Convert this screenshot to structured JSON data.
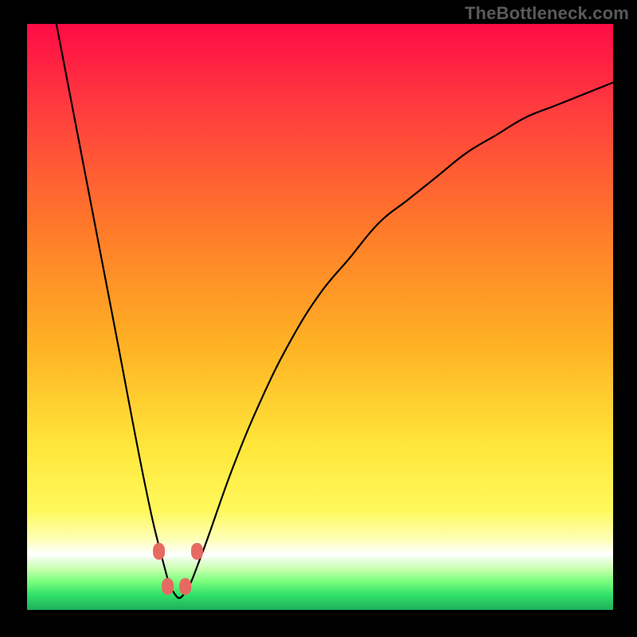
{
  "watermark": "TheBottleneck.com",
  "chart_data": {
    "type": "line",
    "title": "",
    "xlabel": "",
    "ylabel": "",
    "xlim": [
      0,
      100
    ],
    "ylim": [
      0,
      100
    ],
    "grid": false,
    "legend": false,
    "series": [
      {
        "name": "bottleneck-curve",
        "x": [
          5,
          10,
          15,
          20,
          23,
          25,
          27,
          30,
          35,
          40,
          45,
          50,
          55,
          60,
          65,
          70,
          75,
          80,
          85,
          90,
          95,
          100
        ],
        "y": [
          100,
          74,
          48,
          22,
          9,
          3,
          3,
          10,
          24,
          36,
          46,
          54,
          60,
          66,
          70,
          74,
          78,
          81,
          84,
          86,
          88,
          90
        ]
      }
    ],
    "good_band": {
      "y_start": 0,
      "y_end": 7
    },
    "markers": {
      "name": "curve-markers",
      "points": [
        {
          "x": 22.5,
          "y": 10
        },
        {
          "x": 24.0,
          "y": 4
        },
        {
          "x": 27.0,
          "y": 4
        },
        {
          "x": 29.0,
          "y": 10
        }
      ]
    },
    "gradient_stops": [
      {
        "offset": 0.0,
        "color": "#ff0b46"
      },
      {
        "offset": 0.15,
        "color": "#ff3e3e"
      },
      {
        "offset": 0.35,
        "color": "#ff7a2a"
      },
      {
        "offset": 0.55,
        "color": "#ffb224"
      },
      {
        "offset": 0.72,
        "color": "#ffe63a"
      },
      {
        "offset": 0.83,
        "color": "#fff95c"
      },
      {
        "offset": 0.88,
        "color": "#fdffb8"
      },
      {
        "offset": 0.905,
        "color": "#ffffff"
      },
      {
        "offset": 0.93,
        "color": "#c8ffb0"
      },
      {
        "offset": 0.95,
        "color": "#7fff7f"
      },
      {
        "offset": 0.975,
        "color": "#2fe06a"
      },
      {
        "offset": 1.0,
        "color": "#1fae5c"
      }
    ]
  }
}
